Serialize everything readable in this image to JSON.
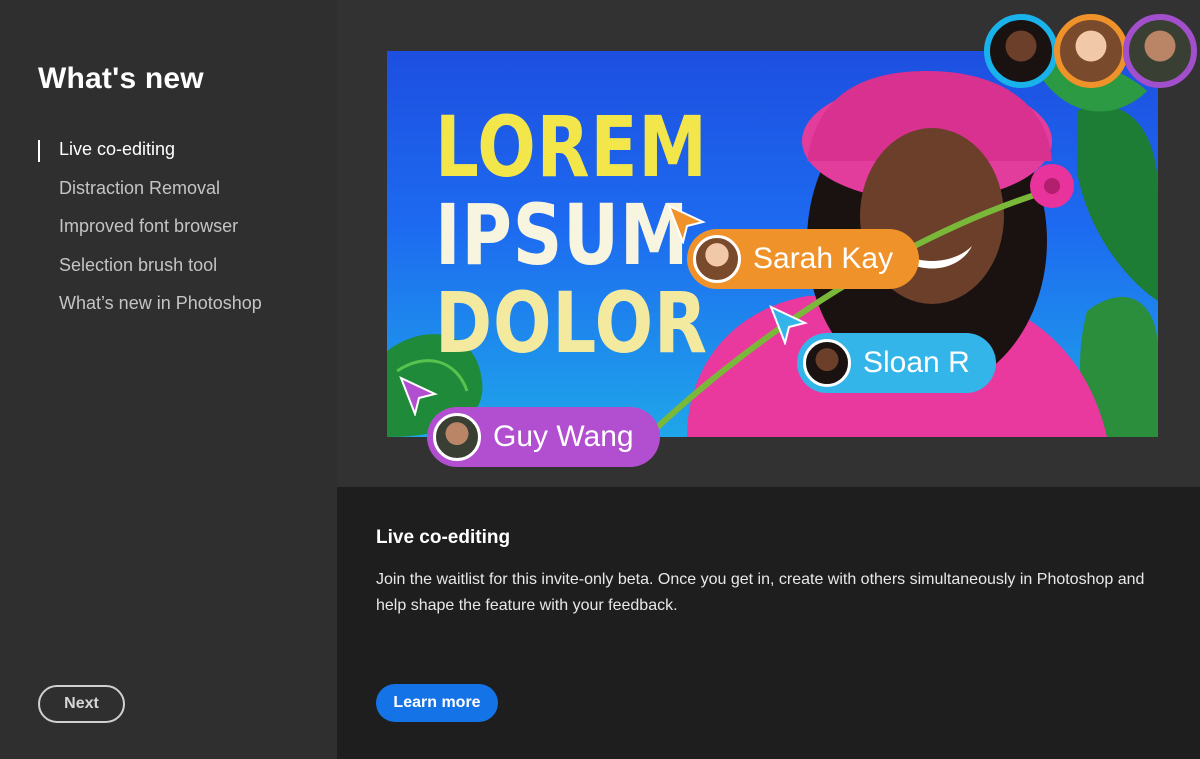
{
  "sidebar": {
    "title": "What's new",
    "items": [
      {
        "label": "Live co-editing",
        "active": true
      },
      {
        "label": "Distraction Removal",
        "active": false
      },
      {
        "label": "Improved font browser",
        "active": false
      },
      {
        "label": "Selection brush tool",
        "active": false
      },
      {
        "label": "What’s new in Photoshop",
        "active": false
      }
    ],
    "next_label": "Next"
  },
  "hero": {
    "headline_lines": [
      "LOREM",
      "IPSUM",
      "DOLOR"
    ],
    "collaborators": [
      {
        "name": "Sarah Kay",
        "color": "#f0922a"
      },
      {
        "name": "Sloan R",
        "color": "#34b5ea"
      },
      {
        "name": "Guy Wang",
        "color": "#b24fd0"
      }
    ],
    "avatar_ring_colors": [
      "#1ab2ea",
      "#f0922a",
      "#a24fcc"
    ]
  },
  "panel": {
    "heading": "Live co-editing",
    "body": "Join the waitlist for this invite-only beta. Once you get in, create with others simultaneously in Photoshop and help shape the feature with your feedback.",
    "learn_more_label": "Learn more"
  },
  "colors": {
    "accent": "#1473e6",
    "sidebar_bg": "#2f2f2f",
    "panel_bg": "#1e1e1e"
  }
}
